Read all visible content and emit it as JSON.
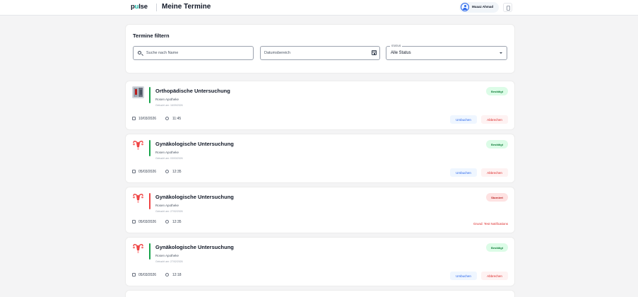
{
  "header": {
    "logo_prefix": "p",
    "logo_o": "u",
    "logo_suffix": "lse",
    "page_title": "Meine Termine",
    "user_name": "Muaaz Ahmad"
  },
  "filter": {
    "title": "Termine filtern",
    "search_placeholder": "Suche nach Name",
    "date_placeholder": "Datumsbereich",
    "status_label": "STATUS",
    "status_value": "Alle Status"
  },
  "colors": {
    "confirmed": "#16a34a",
    "cancelled": "#ef4444"
  },
  "appointments": [
    {
      "icon": "orthopedic-image",
      "title": "Orthopädische Untersuchung",
      "place": "Rosen Apotheke",
      "booked": "Gebucht am: 16/09/2026",
      "status": "Bestätigt",
      "date": "10/03/2026",
      "time": "11:45",
      "rebook": "Umbuchen",
      "cancel": "Abbrechen"
    },
    {
      "icon": "uterus-icon",
      "title": "Gynäkologische Untersuchung",
      "place": "Rosen Apotheke",
      "booked": "Gebucht am: 03/03/2026",
      "status": "Bestätigt",
      "date": "05/03/2026",
      "time": "12:35",
      "rebook": "Umbuchen",
      "cancel": "Abbrechen"
    },
    {
      "icon": "uterus-icon",
      "title": "Gynäkologische Untersuchung",
      "place": "Rosen Apotheke",
      "booked": "Gebucht am: 27/02/2026",
      "status": "Storniert",
      "date": "05/03/2026",
      "time": "12:35",
      "reason": "Grund: Test Notifications"
    },
    {
      "icon": "uterus-icon",
      "title": "Gynäkologische Untersuchung",
      "place": "Rosen Apotheke",
      "booked": "Gebucht am: 27/02/2026",
      "status": "Bestätigt",
      "date": "05/03/2026",
      "time": "12:18",
      "rebook": "Umbuchen",
      "cancel": "Abbrechen"
    }
  ]
}
